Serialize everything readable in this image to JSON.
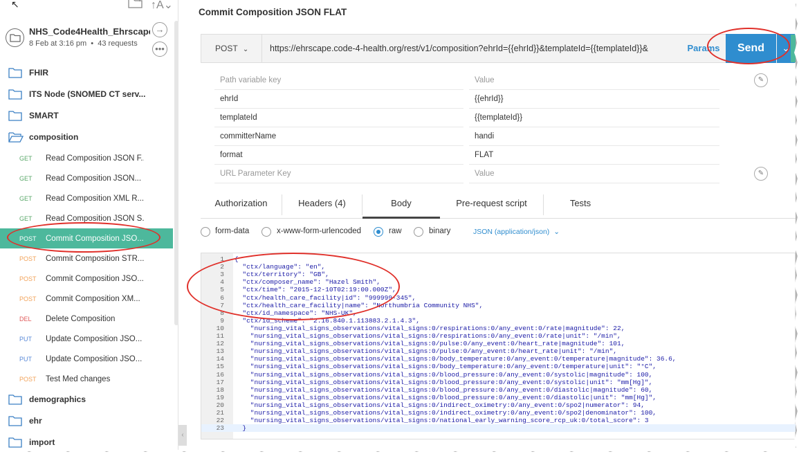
{
  "toolbar_icons": [
    "new-folder-icon",
    "sort-icon"
  ],
  "collection": {
    "name": "NHS_Code4Health_Ehrscape",
    "date": "8 Feb at 3:16 pm",
    "requests": "43 requests"
  },
  "sidebar": {
    "folders_top": [
      {
        "label": "FHIR"
      },
      {
        "label": "ITS Node (SNOMED CT serv..."
      },
      {
        "label": "SMART"
      },
      {
        "label": "composition"
      }
    ],
    "requests": [
      {
        "method": "GET",
        "label": "Read Composition JSON F..."
      },
      {
        "method": "GET",
        "label": "Read Composition JSON..."
      },
      {
        "method": "GET",
        "label": "Read Composition XML R..."
      },
      {
        "method": "GET",
        "label": "Read Composition JSON S..."
      },
      {
        "method": "POST",
        "label": "Commit Composition JSO...",
        "active": true
      },
      {
        "method": "POST",
        "label": "Commit Composition STR..."
      },
      {
        "method": "POST",
        "label": "Commit Composition JSO..."
      },
      {
        "method": "POST",
        "label": "Commit Composition XM..."
      },
      {
        "method": "DEL",
        "label": "Delete Composition"
      },
      {
        "method": "PUT",
        "label": "Update Composition JSO..."
      },
      {
        "method": "PUT",
        "label": "Update Composition JSO..."
      },
      {
        "method": "POST",
        "label": "Test Med changes"
      }
    ],
    "folders_bottom": [
      {
        "label": "demographics"
      },
      {
        "label": "ehr"
      },
      {
        "label": "import"
      }
    ]
  },
  "request": {
    "title": "Commit Composition JSON FLAT",
    "method": "POST",
    "url": "https://ehrscape.code-4-health.org/rest/v1/composition?ehrId={{ehrId}}&templateId={{templateId}}&",
    "params_label": "Params",
    "send_label": "Send"
  },
  "path_vars": {
    "key_placeholder": "Path variable key",
    "value_placeholder": "Value",
    "rows": [
      {
        "key": "ehrId",
        "value": "{{ehrId}}"
      },
      {
        "key": "templateId",
        "value": "{{templateId}}"
      },
      {
        "key": "committerName",
        "value": "handi"
      },
      {
        "key": "format",
        "value": "FLAT"
      }
    ],
    "url_key_placeholder": "URL Parameter Key",
    "url_value_placeholder": "Value"
  },
  "tabs": [
    "Authorization",
    "Headers (4)",
    "Body",
    "Pre-request script",
    "Tests"
  ],
  "active_tab": "Body",
  "body_options": {
    "form_data": "form-data",
    "urlencoded": "x-www-form-urlencoded",
    "raw": "raw",
    "binary": "binary",
    "content_type": "JSON (application/json)"
  },
  "code_lines": [
    "{",
    "  \"ctx/language\": \"en\",",
    "  \"ctx/territory\": \"GB\",",
    "  \"ctx/composer_name\": \"Hazel Smith\",",
    "  \"ctx/time\": \"2015-12-10T02:19:00.000Z\",",
    "  \"ctx/health_care_facility|id\": \"999999-345\",",
    "  \"ctx/health_care_facility|name\": \"Northumbria Community NHS\",",
    "  \"ctx/id_namespace\": \"NHS-UK\",",
    "  \"ctx/id_scheme\": \"2.16.840.1.113883.2.1.4.3\",",
    "    \"nursing_vital_signs_observations/vital_signs:0/respirations:0/any_event:0/rate|magnitude\": 22,",
    "    \"nursing_vital_signs_observations/vital_signs:0/respirations:0/any_event:0/rate|unit\": \"/min\",",
    "    \"nursing_vital_signs_observations/vital_signs:0/pulse:0/any_event:0/heart_rate|magnitude\": 101,",
    "    \"nursing_vital_signs_observations/vital_signs:0/pulse:0/any_event:0/heart_rate|unit\": \"/min\",",
    "    \"nursing_vital_signs_observations/vital_signs:0/body_temperature:0/any_event:0/temperature|magnitude\": 36.6,",
    "    \"nursing_vital_signs_observations/vital_signs:0/body_temperature:0/any_event:0/temperature|unit\": \"°C\",",
    "    \"nursing_vital_signs_observations/vital_signs:0/blood_pressure:0/any_event:0/systolic|magnitude\": 100,",
    "    \"nursing_vital_signs_observations/vital_signs:0/blood_pressure:0/any_event:0/systolic|unit\": \"mm[Hg]\",",
    "    \"nursing_vital_signs_observations/vital_signs:0/blood_pressure:0/any_event:0/diastolic|magnitude\": 60,",
    "    \"nursing_vital_signs_observations/vital_signs:0/blood_pressure:0/any_event:0/diastolic|unit\": \"mm[Hg]\",",
    "    \"nursing_vital_signs_observations/vital_signs:0/indirect_oximetry:0/any_event:0/spo2|numerator\": 94,",
    "    \"nursing_vital_signs_observations/vital_signs:0/indirect_oximetry:0/any_event:0/spo2|denominator\": 100,",
    "    \"nursing_vital_signs_observations/vital_signs:0/national_early_warning_score_rcp_uk:0/total_score\": 3",
    "  }"
  ],
  "colors": {
    "accent": "#2f8dcf",
    "active_item": "#4db89c",
    "annotation": "#e0302a",
    "get": "#5aa86a",
    "post": "#f2a35a",
    "delete": "#e05a5a",
    "put": "#5a8ad8"
  }
}
